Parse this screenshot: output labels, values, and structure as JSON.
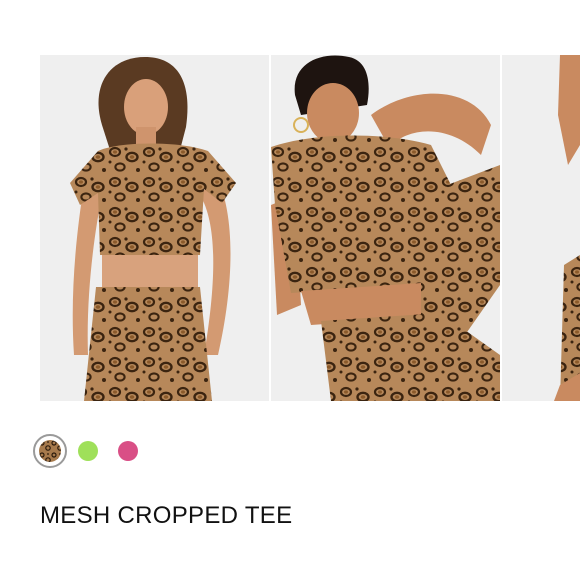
{
  "product": {
    "title": "MESH CROPPED TEE",
    "images": [
      {
        "alt": "model-front-view"
      },
      {
        "alt": "model-seated-view"
      },
      {
        "alt": "model-partial-view"
      }
    ],
    "swatches": [
      {
        "name": "leopard",
        "color": "#8a5a2b",
        "selected": true
      },
      {
        "name": "green",
        "color": "#9fe05a",
        "selected": false
      },
      {
        "name": "pink",
        "color": "#d94f86",
        "selected": false
      }
    ]
  },
  "colors": {
    "background": "#ffffff",
    "image_bg": "#efefef",
    "leopard_base": "#b7885a",
    "leopard_spot": "#3b2410",
    "swatch_ring": "#9a9a9a",
    "title_text": "#111111"
  }
}
